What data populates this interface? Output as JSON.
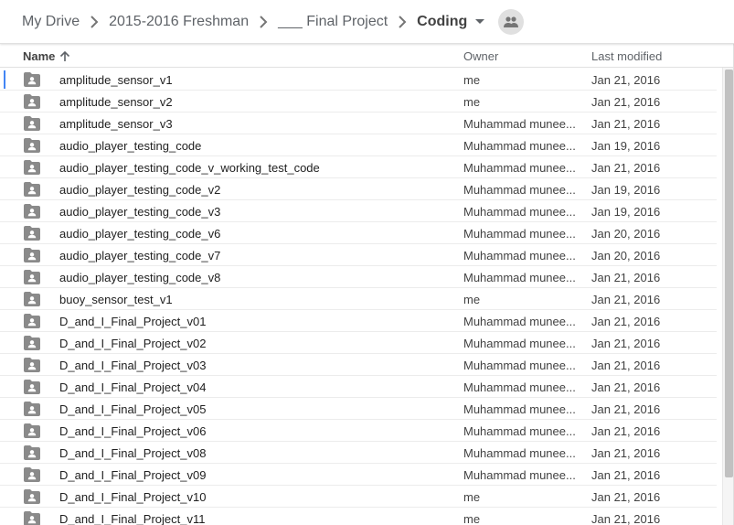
{
  "breadcrumb": {
    "items": [
      "My Drive",
      "2015-2016 Freshman",
      "___ Final Project"
    ],
    "current": "Coding"
  },
  "icons": {
    "separator": "chevron-right-icon",
    "folder_menu": "caret-down-icon",
    "share": "people-icon",
    "sort": "arrow-up-icon",
    "row": "shared-folder-icon"
  },
  "columns": {
    "name": "Name",
    "owner": "Owner",
    "modified": "Last modified"
  },
  "colors": {
    "focus": "#4285f4",
    "folder": "#8a8a8a"
  },
  "files": [
    {
      "name": "amplitude_sensor_v1",
      "owner": "me",
      "modified": "Jan 21, 2016"
    },
    {
      "name": "amplitude_sensor_v2",
      "owner": "me",
      "modified": "Jan 21, 2016"
    },
    {
      "name": "amplitude_sensor_v3",
      "owner": "Muhammad munee...",
      "modified": "Jan 21, 2016"
    },
    {
      "name": "audio_player_testing_code",
      "owner": "Muhammad munee...",
      "modified": "Jan 19, 2016"
    },
    {
      "name": "audio_player_testing_code_v_working_test_code",
      "owner": "Muhammad munee...",
      "modified": "Jan 21, 2016"
    },
    {
      "name": "audio_player_testing_code_v2",
      "owner": "Muhammad munee...",
      "modified": "Jan 19, 2016"
    },
    {
      "name": "audio_player_testing_code_v3",
      "owner": "Muhammad munee...",
      "modified": "Jan 19, 2016"
    },
    {
      "name": "audio_player_testing_code_v6",
      "owner": "Muhammad munee...",
      "modified": "Jan 20, 2016"
    },
    {
      "name": "audio_player_testing_code_v7",
      "owner": "Muhammad munee...",
      "modified": "Jan 20, 2016"
    },
    {
      "name": "audio_player_testing_code_v8",
      "owner": "Muhammad munee...",
      "modified": "Jan 21, 2016"
    },
    {
      "name": "buoy_sensor_test_v1",
      "owner": "me",
      "modified": "Jan 21, 2016"
    },
    {
      "name": "D_and_I_Final_Project_v01",
      "owner": "Muhammad munee...",
      "modified": "Jan 21, 2016"
    },
    {
      "name": "D_and_I_Final_Project_v02",
      "owner": "Muhammad munee...",
      "modified": "Jan 21, 2016"
    },
    {
      "name": "D_and_I_Final_Project_v03",
      "owner": "Muhammad munee...",
      "modified": "Jan 21, 2016"
    },
    {
      "name": "D_and_I_Final_Project_v04",
      "owner": "Muhammad munee...",
      "modified": "Jan 21, 2016"
    },
    {
      "name": "D_and_I_Final_Project_v05",
      "owner": "Muhammad munee...",
      "modified": "Jan 21, 2016"
    },
    {
      "name": "D_and_I_Final_Project_v06",
      "owner": "Muhammad munee...",
      "modified": "Jan 21, 2016"
    },
    {
      "name": "D_and_I_Final_Project_v08",
      "owner": "Muhammad munee...",
      "modified": "Jan 21, 2016"
    },
    {
      "name": "D_and_I_Final_Project_v09",
      "owner": "Muhammad munee...",
      "modified": "Jan 21, 2016"
    },
    {
      "name": "D_and_I_Final_Project_v10",
      "owner": "me",
      "modified": "Jan 21, 2016"
    },
    {
      "name": "D_and_I_Final_Project_v11",
      "owner": "me",
      "modified": "Jan 21, 2016"
    }
  ]
}
